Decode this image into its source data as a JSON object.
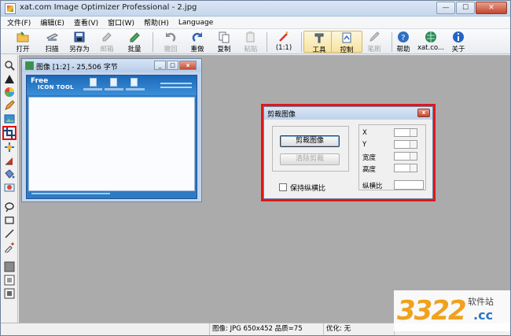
{
  "window": {
    "title": "xat.com  Image Optimizer Professional - 2.jpg",
    "min": "—",
    "max": "☐",
    "close": "✕"
  },
  "menu": [
    "文件(F)",
    "编辑(E)",
    "查看(V)",
    "窗口(W)",
    "帮助(H)",
    "Language"
  ],
  "toolbar": {
    "open": "打开",
    "scan": "扫描",
    "save_as": "另存为",
    "email": "邮箱",
    "batch": "批量",
    "undo": "撤回",
    "redo": "重做",
    "copy": "复制",
    "paste": "粘贴",
    "actual": "(1:1)",
    "tools": "工具",
    "control": "控制",
    "brush": "笔刷",
    "help": "帮助",
    "site": "xat.co...",
    "about": "关于"
  },
  "image_window": {
    "title": "图像  [1:2] - 25,506 字节",
    "logo_top": "Free",
    "logo_bottom": "ICON TOOL",
    "min": "_",
    "max": "□",
    "close": "x"
  },
  "crop_dialog": {
    "title": "剪裁图像",
    "close": "x",
    "crop_button": "剪裁图像",
    "clear_button": "清除剪裁",
    "keep_ratio": "保持纵横比",
    "keep_ratio_checked": false,
    "fields": {
      "x": "X",
      "y": "Y",
      "width": "宽度",
      "height": "高度",
      "ratio": "纵横比"
    }
  },
  "statusbar": {
    "image_info": "图像: JPG 650x452  品质=75",
    "optimize": "优化: 无"
  },
  "watermark": {
    "number": "3322",
    "site_cn": "软件站",
    "domain": ".cc"
  },
  "colors": {
    "accent_red": "#e01818",
    "canvas_blue": "#2c7bc4",
    "workspace": "#ababab"
  }
}
